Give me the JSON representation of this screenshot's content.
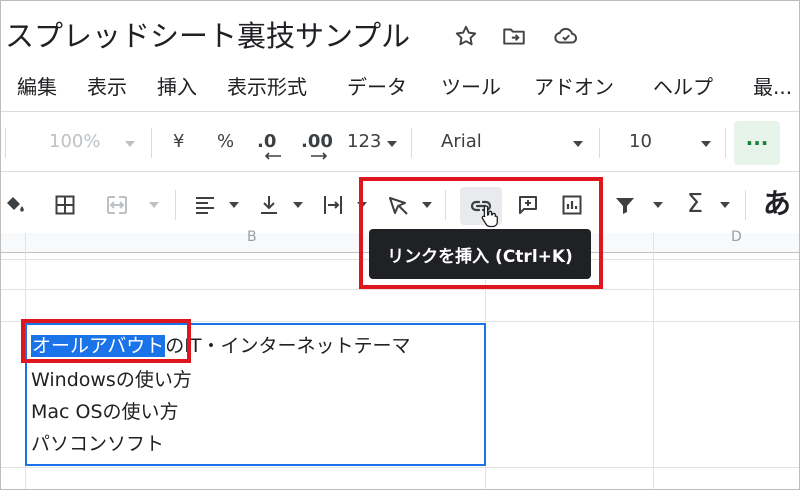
{
  "title_bar": {
    "doc_title": "スプレッドシート裏技サンプル",
    "icons": [
      "star-icon",
      "move-folder-icon",
      "cloud-status-icon"
    ]
  },
  "menu": {
    "items": [
      "編集",
      "表示",
      "挿入",
      "表示形式",
      "データ",
      "ツール",
      "アドオン",
      "ヘルプ",
      "最..."
    ]
  },
  "toolbar1": {
    "zoom": "100%",
    "currency": "¥",
    "percent": "%",
    "decimal_decrease": ".0",
    "decimal_increase": ".00",
    "more_formats": "123",
    "font": "Arial",
    "font_size": "10",
    "more_label": "···"
  },
  "toolbar2": {
    "icons": [
      "fill-color-icon",
      "borders-icon",
      "merge-cells-icon",
      "horizontal-align-icon",
      "vertical-align-icon",
      "text-wrap-icon",
      "text-rotate-icon",
      "insert-link-icon",
      "insert-comment-icon",
      "insert-chart-icon",
      "filter-icon",
      "functions-icon",
      "input-tools-icon"
    ],
    "functions_symbol": "Σ",
    "input_tools_glyph": "あ"
  },
  "tooltip": {
    "text": "リンクを挿入 (Ctrl+K)"
  },
  "sheet": {
    "col_letters": [
      "B",
      "D"
    ],
    "cell_lines": {
      "selected_part": "オールアバウト",
      "line1_rest": "のIT・インターネットテーマ",
      "line2": "Windowsの使い方",
      "line3": "Mac OSの使い方",
      "line4": "パソコンソフト"
    }
  },
  "colors": {
    "highlight_red": "#e0161f",
    "selection_blue": "#1a73e8",
    "more_button_bg": "#e6f4ea",
    "tooltip_bg": "#202124"
  }
}
